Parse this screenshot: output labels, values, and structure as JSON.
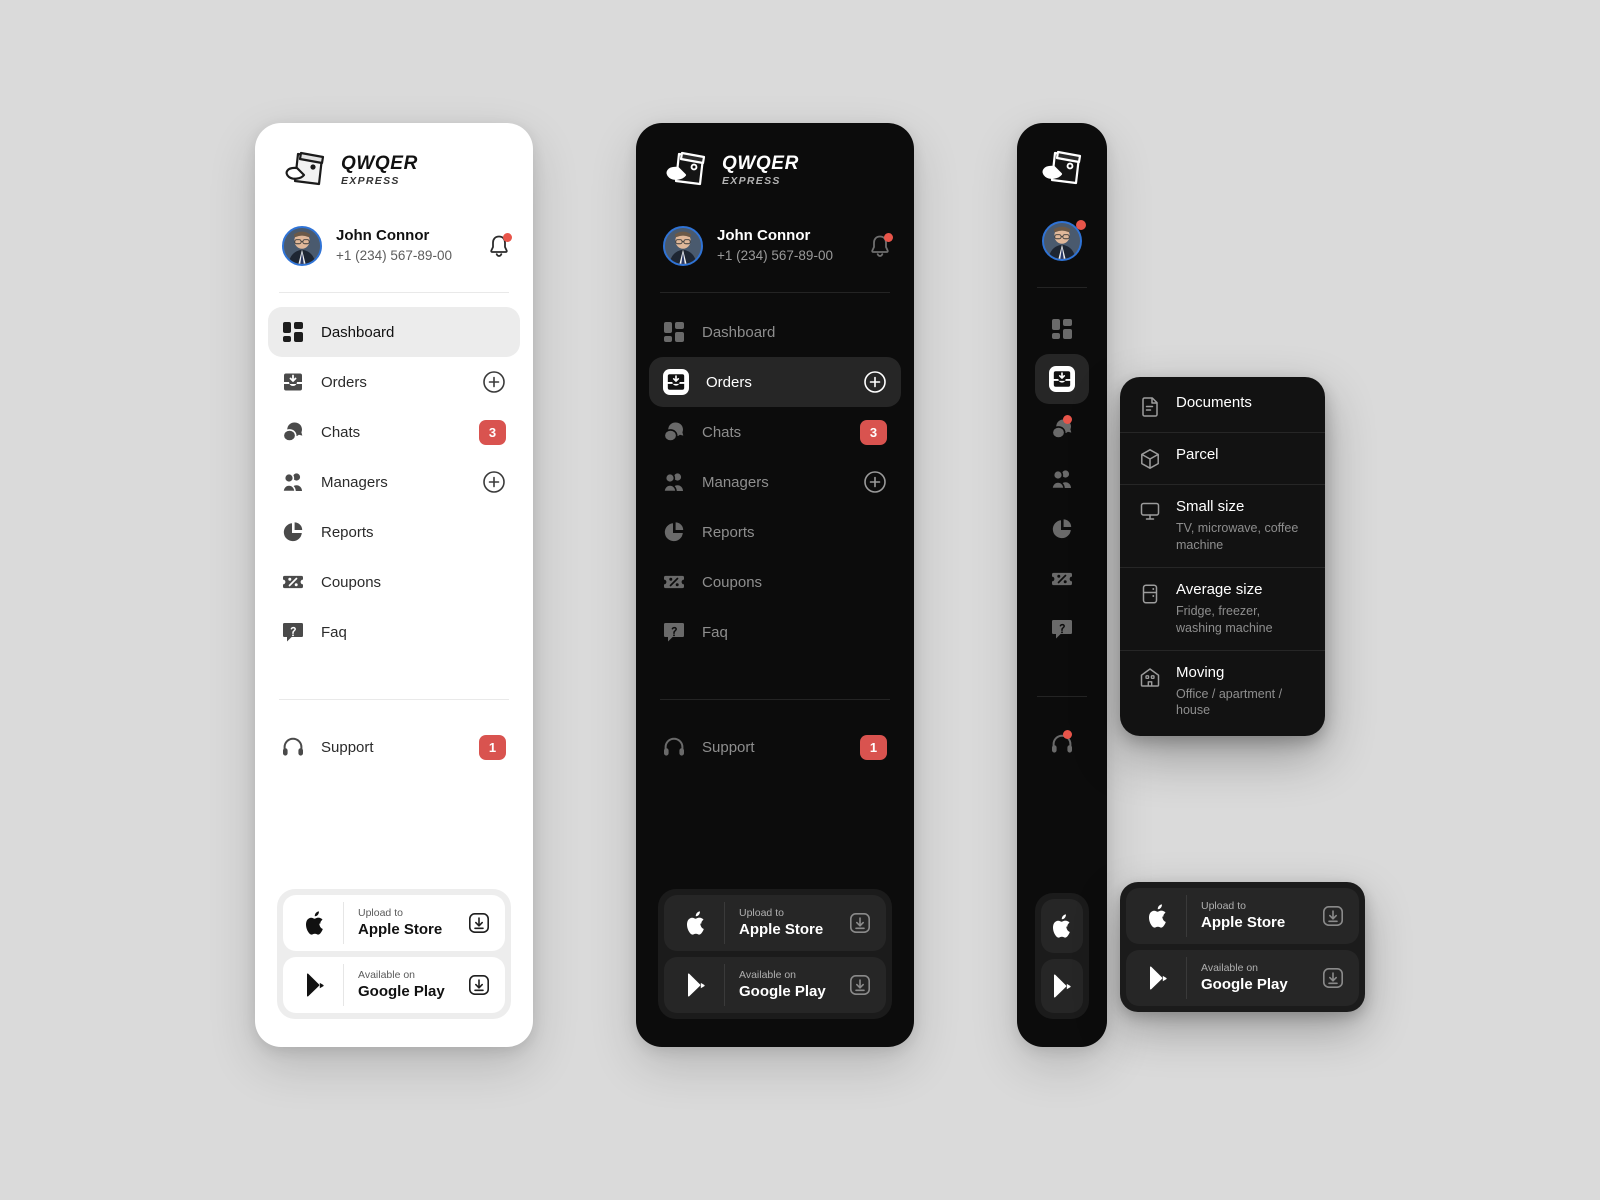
{
  "brand": {
    "name": "QWQER",
    "tagline": "EXPRESS",
    "logo_icon": "bird-box-logo-icon"
  },
  "user": {
    "name": "John Connor",
    "phone": "+1 (234) 567-89-00",
    "avatar_icon": "user-avatar",
    "notification_icon": "bell-icon",
    "has_notification": true
  },
  "colors": {
    "page_background": "#dadada",
    "light_panel": "#ffffff",
    "dark_panel": "#0c0c0c",
    "badge_red": "#d9534f",
    "dot_red": "#e8554a",
    "avatar_ring": "#2f73d6",
    "active_light": "#ececec",
    "active_dark": "#262626"
  },
  "nav": {
    "primary": [
      {
        "label": "Dashboard",
        "icon": "dashboard-grid-icon",
        "action": null,
        "badge": null,
        "active_light": true,
        "active_dark": false
      },
      {
        "label": "Orders",
        "icon": "orders-inbox-icon",
        "action": "plus",
        "badge": null,
        "active_light": false,
        "active_dark": true
      },
      {
        "label": "Chats",
        "icon": "chats-bubble-icon",
        "action": null,
        "badge": "3",
        "active_light": false,
        "active_dark": false
      },
      {
        "label": "Managers",
        "icon": "managers-people-icon",
        "action": "plus",
        "badge": null,
        "active_light": false,
        "active_dark": false
      },
      {
        "label": "Reports",
        "icon": "reports-pie-icon",
        "action": null,
        "badge": null,
        "active_light": false,
        "active_dark": false
      },
      {
        "label": "Coupons",
        "icon": "coupons-ticket-icon",
        "action": null,
        "badge": null,
        "active_light": false,
        "active_dark": false
      },
      {
        "label": "Faq",
        "icon": "faq-question-icon",
        "action": null,
        "badge": null,
        "active_light": false,
        "active_dark": false
      }
    ],
    "secondary": [
      {
        "label": "Support",
        "icon": "support-headphones-icon",
        "action": null,
        "badge": "1"
      }
    ]
  },
  "store_buttons": [
    {
      "top_label": "Upload to",
      "main_label": "Apple Store",
      "icon": "apple-icon",
      "action_icon": "download-icon"
    },
    {
      "top_label": "Available on",
      "main_label": "Google Play",
      "icon": "google-play-icon",
      "action_icon": "download-icon"
    }
  ],
  "dropdown": {
    "items": [
      {
        "title": "Documents",
        "subtitle": "",
        "icon": "document-icon"
      },
      {
        "title": "Parcel",
        "subtitle": "",
        "icon": "parcel-box-icon"
      },
      {
        "title": "Small size",
        "subtitle": "TV, microwave, coffee machine",
        "icon": "monitor-icon"
      },
      {
        "title": "Average size",
        "subtitle": "Fridge, freezer, washing machine",
        "icon": "fridge-icon"
      },
      {
        "title": "Moving",
        "subtitle": "Office / apartment / house",
        "icon": "house-icon"
      }
    ]
  }
}
